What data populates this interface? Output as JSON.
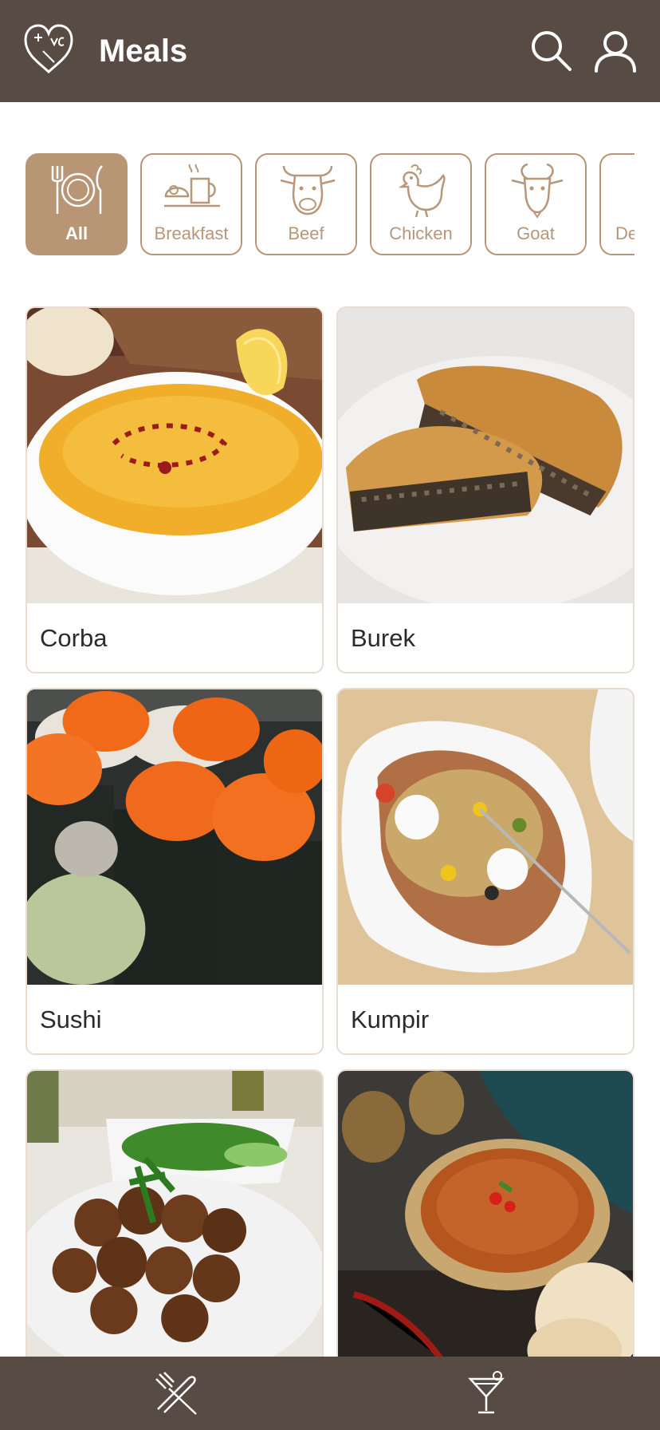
{
  "header": {
    "title": "Meals",
    "logo_icon": "heart-logo-icon",
    "actions": [
      {
        "name": "search",
        "icon": "search-icon"
      },
      {
        "name": "profile",
        "icon": "user-icon"
      }
    ],
    "color": "#584b43"
  },
  "categories": [
    {
      "label": "All",
      "icon": "plate-cutlery-icon",
      "selected": true
    },
    {
      "label": "Breakfast",
      "icon": "breakfast-icon",
      "selected": false
    },
    {
      "label": "Beef",
      "icon": "cow-icon",
      "selected": false
    },
    {
      "label": "Chicken",
      "icon": "chicken-icon",
      "selected": false
    },
    {
      "label": "Goat",
      "icon": "goat-icon",
      "selected": false
    },
    {
      "label": "De",
      "icon": "dessert-icon",
      "selected": false
    }
  ],
  "meals": [
    {
      "name": "Corba"
    },
    {
      "name": "Burek"
    },
    {
      "name": "Sushi"
    },
    {
      "name": "Kumpir"
    },
    {
      "name": ""
    },
    {
      "name": ""
    }
  ],
  "bottom_nav": [
    {
      "name": "meals",
      "icon": "cutlery-icon",
      "active": true
    },
    {
      "name": "drinks",
      "icon": "cocktail-icon",
      "active": false
    }
  ],
  "colors": {
    "accent": "#b89574",
    "outline": "#b8967a",
    "bar": "#584b43"
  }
}
